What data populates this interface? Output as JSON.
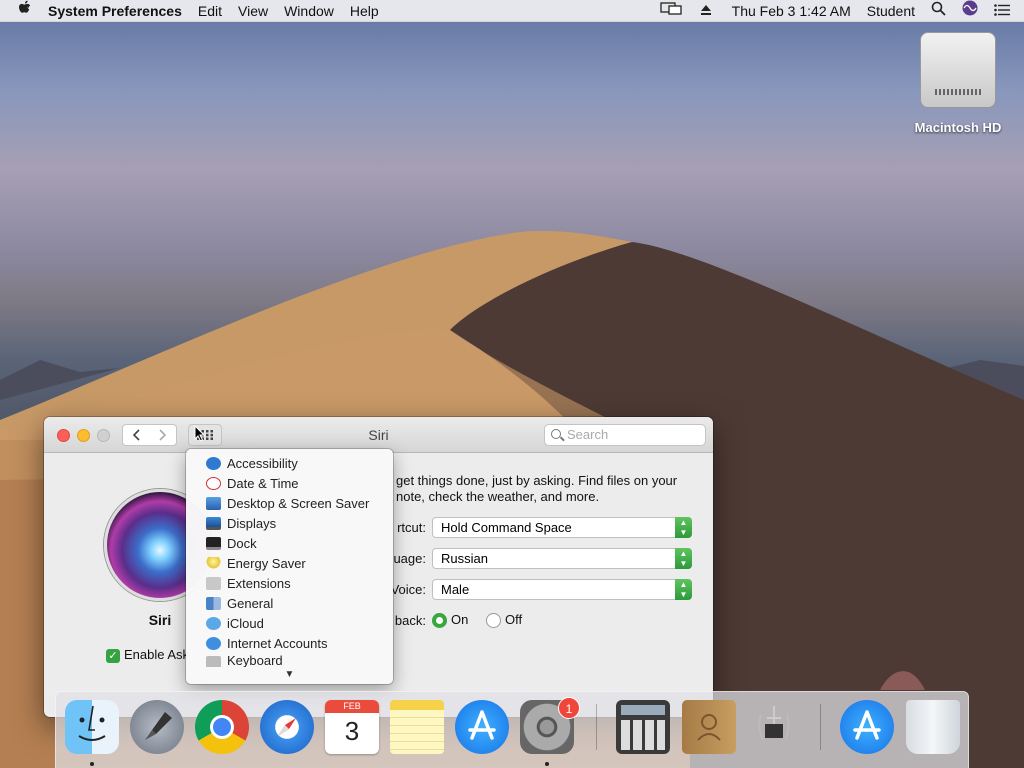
{
  "menubar": {
    "apple": "",
    "app_name": "System Preferences",
    "menus": [
      "Edit",
      "View",
      "Window",
      "Help"
    ],
    "clock": "Thu Feb 3  1:42 AM",
    "user": "Student"
  },
  "desktop": {
    "drive_label": "Macintosh HD"
  },
  "window": {
    "title": "Siri",
    "search_placeholder": "Search",
    "siri_label": "Siri",
    "description_line1": "get things done, just by asking. Find files on your",
    "description_line2": "note, check the weather, and more.",
    "enable_checkbox_label": "Enable Ask",
    "rows": [
      {
        "label": "rtcut:",
        "value": "Hold Command Space"
      },
      {
        "label": "uage:",
        "value": "Russian"
      },
      {
        "label": "Voice:",
        "value": "Male"
      }
    ],
    "feedback_label": "back:",
    "feedback_on": "On",
    "feedback_off": "Off",
    "feedback_selected": "On"
  },
  "dropdown": {
    "items": [
      {
        "label": "Accessibility",
        "icon": "accessibility-icon"
      },
      {
        "label": "Date & Time",
        "icon": "clock-icon"
      },
      {
        "label": "Desktop & Screen Saver",
        "icon": "desktop-icon"
      },
      {
        "label": "Displays",
        "icon": "display-icon"
      },
      {
        "label": "Dock",
        "icon": "dock-icon"
      },
      {
        "label": "Energy Saver",
        "icon": "lightbulb-icon"
      },
      {
        "label": "Extensions",
        "icon": "puzzle-icon"
      },
      {
        "label": "General",
        "icon": "general-icon"
      },
      {
        "label": "iCloud",
        "icon": "cloud-icon"
      },
      {
        "label": "Internet Accounts",
        "icon": "at-icon"
      },
      {
        "label": "Keyboard",
        "icon": "keyboard-icon"
      }
    ]
  },
  "dock": {
    "apps": [
      {
        "name": "finder-icon",
        "running": true
      },
      {
        "name": "launchpad-icon",
        "running": false
      },
      {
        "name": "chrome-icon",
        "running": false
      },
      {
        "name": "safari-icon",
        "running": false
      },
      {
        "name": "calendar-icon",
        "running": false
      },
      {
        "name": "notes-icon",
        "running": false
      },
      {
        "name": "app-store-icon",
        "running": false
      },
      {
        "name": "system-preferences-icon",
        "running": true
      },
      {
        "name": "calculator-icon",
        "running": false
      },
      {
        "name": "contacts-icon",
        "running": false
      },
      {
        "name": "system-information-icon",
        "running": false
      },
      {
        "name": "downloads-stack-icon",
        "running": false
      },
      {
        "name": "trash-icon",
        "running": false
      }
    ],
    "calendar_month": "FEB",
    "calendar_day": "3",
    "sysprefs_badge": "1"
  }
}
